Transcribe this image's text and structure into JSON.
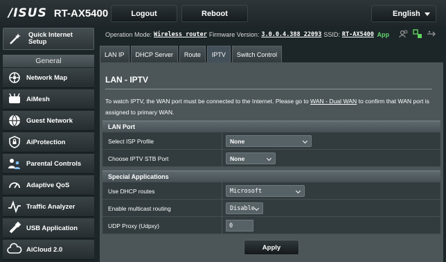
{
  "header": {
    "logo": "/ISUS",
    "model": "RT-AX5400",
    "logout_label": "Logout",
    "reboot_label": "Reboot",
    "language": "English"
  },
  "sidebar": {
    "quick_setup": "Quick Internet Setup",
    "general_header": "General",
    "items": [
      {
        "label": "Network Map",
        "icon": "network-map-icon"
      },
      {
        "label": "AiMesh",
        "icon": "aimesh-icon"
      },
      {
        "label": "Guest Network",
        "icon": "guest-network-icon"
      },
      {
        "label": "AiProtection",
        "icon": "shield-icon"
      },
      {
        "label": "Parental Controls",
        "icon": "parental-controls-icon"
      },
      {
        "label": "Adaptive QoS",
        "icon": "gauge-icon"
      },
      {
        "label": "Traffic Analyzer",
        "icon": "traffic-analyzer-icon"
      },
      {
        "label": "USB Application",
        "icon": "usb-icon"
      },
      {
        "label": "AiCloud 2.0",
        "icon": "cloud-icon"
      }
    ]
  },
  "status": {
    "op_mode_label": "Operation Mode:",
    "op_mode_value": "Wireless router",
    "firmware_label": "Firmware Version:",
    "firmware_value": "3.0.0.4.388_22093",
    "ssid_label": "SSID:",
    "ssid_value": "RT-AX5400",
    "app_label": "App"
  },
  "tabs": [
    "LAN IP",
    "DHCP Server",
    "Route",
    "IPTV",
    "Switch Control"
  ],
  "page": {
    "title": "LAN - IPTV",
    "desc_part1": "To watch IPTV, the WAN port must be connected to the Internet. Please go to ",
    "desc_link": "WAN - Dual WAN",
    "desc_part2": " to confirm that WAN port is assigned to primary WAN.",
    "lan_port_header": "LAN Port",
    "isp_profile_label": "Select ISP Profile",
    "isp_profile_value": "None",
    "stb_port_label": "Choose IPTV STB Port",
    "stb_port_value": "None",
    "special_header": "Special Applications",
    "dhcp_routes_label": "Use DHCP routes",
    "dhcp_routes_value": "Microsoft",
    "multicast_label": "Enable multicast routing",
    "multicast_value": "Disable",
    "udp_proxy_label": "UDP Proxy (Udpxy)",
    "udp_proxy_value": "0",
    "apply_label": "Apply"
  }
}
